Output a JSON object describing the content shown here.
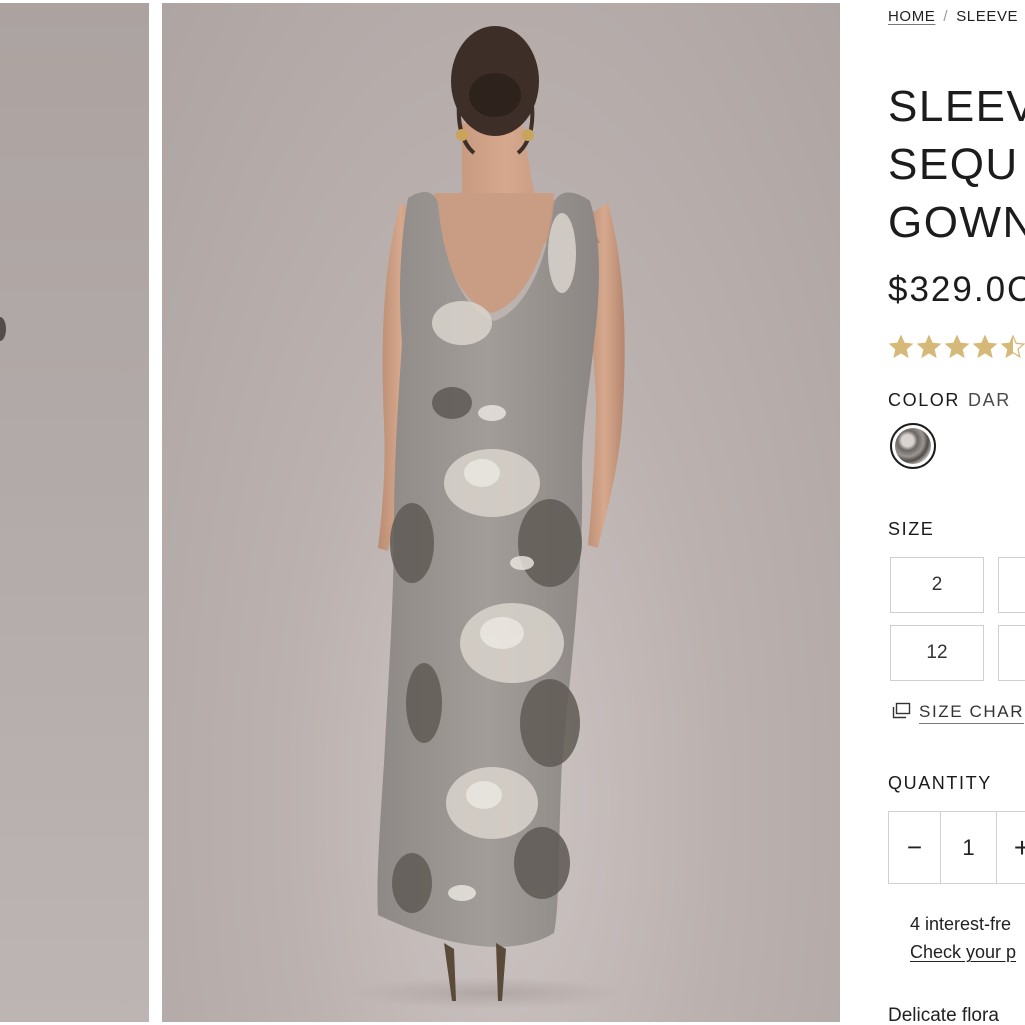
{
  "gallery": {
    "main_image_alt": "Model wearing sleeveless sequin floral gown, back view"
  },
  "breadcrumb": {
    "home": "HOME",
    "separator": "/",
    "current": "SLEEVE"
  },
  "product": {
    "title_lines": [
      "SLEEV",
      "SEQU",
      "GOWN"
    ],
    "price": "$329.0C",
    "rating": 4.5,
    "rating_max": 5
  },
  "color": {
    "label": "COLOR",
    "value": "DAR"
  },
  "size": {
    "label": "SIZE",
    "options": [
      "2",
      "12"
    ],
    "chart_label": "SIZE CHAR"
  },
  "quantity": {
    "label": "QUANTITY",
    "minus": "−",
    "value": "1",
    "plus": "+"
  },
  "payment": {
    "installments_text": "4 interest-fre",
    "check_link": "Check your p"
  },
  "description": {
    "snippet": "Delicate flora"
  },
  "colors": {
    "star": "#d6b978",
    "text": "#1c1c1c",
    "border": "#cfcfcf",
    "backdrop": "#b3aaa8"
  }
}
